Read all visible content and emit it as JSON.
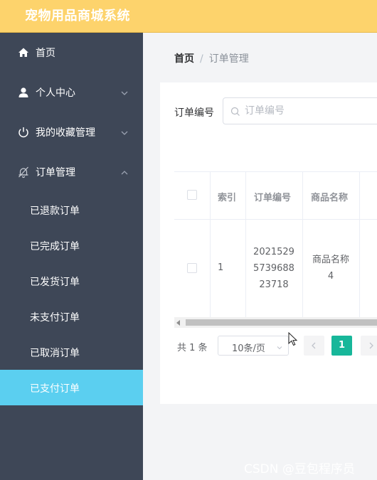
{
  "app": {
    "title": "宠物用品商城系统"
  },
  "sidebar": {
    "items": [
      {
        "label": "首页",
        "icon": "home-icon"
      },
      {
        "label": "个人中心",
        "icon": "user-icon"
      },
      {
        "label": "我的收藏管理",
        "icon": "power-icon"
      },
      {
        "label": "订单管理",
        "icon": "bell-off-icon",
        "expanded": true
      }
    ],
    "sub_items": [
      {
        "label": "已退款订单"
      },
      {
        "label": "已完成订单"
      },
      {
        "label": "已发货订单"
      },
      {
        "label": "未支付订单"
      },
      {
        "label": "已取消订单"
      },
      {
        "label": "已支付订单",
        "active": true
      }
    ],
    "colors": {
      "background": "#3e4757",
      "active": "#5bcff0",
      "header": "#fdd36c"
    }
  },
  "breadcrumb": {
    "home": "首页",
    "separator": "/",
    "current": "订单管理"
  },
  "search": {
    "label": "订单编号",
    "placeholder": "订单编号",
    "value": ""
  },
  "table": {
    "columns": [
      "索引",
      "订单编号",
      "商品名称"
    ],
    "rows": [
      {
        "index": "1",
        "order_no_lines": [
          "2021529",
          "5739688",
          "23718"
        ],
        "product_lines": [
          "商品名称",
          "4"
        ]
      }
    ]
  },
  "pagination": {
    "total": "共 1 条",
    "page_size": "10条/页",
    "current_page": "1",
    "accent": "#17b79a"
  },
  "watermark": "CSDN @豆包程序员"
}
